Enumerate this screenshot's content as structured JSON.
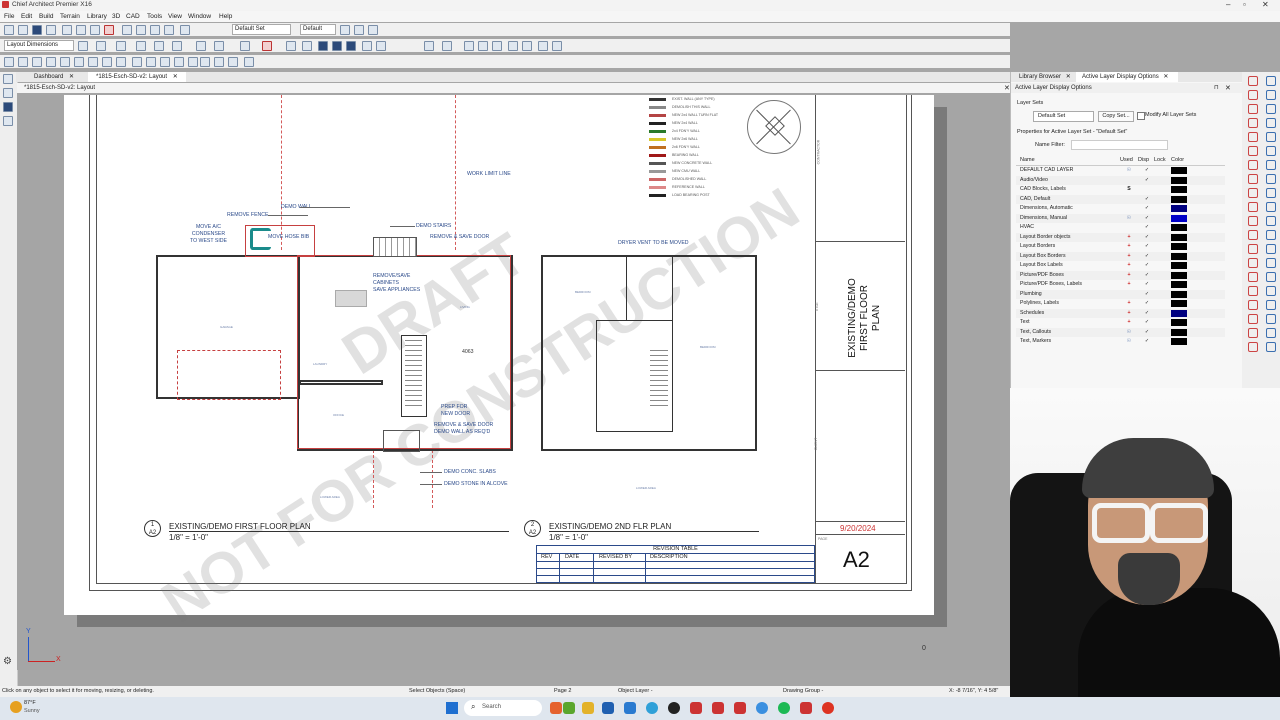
{
  "app": {
    "title": "Chief Architect Premier X16",
    "menus": [
      "File",
      "Edit",
      "Build",
      "Terrain",
      "Library",
      "3D",
      "CAD",
      "Tools",
      "View",
      "Window",
      "Help"
    ],
    "layer_set_dropdown": "Default Set",
    "default_dropdown": "Default",
    "layout_dims_dropdown": "Layout Dimensions"
  },
  "tabs": [
    {
      "label": "Dashboard"
    },
    {
      "label": "*1815-Esch-SD-v2: Layout"
    }
  ],
  "view_header": "*1815-Esch-SD-v2: Layout",
  "drawing": {
    "notes": {
      "demo_wall": "DEMO WALL",
      "remove_fence": "REMOVE FENCE",
      "move_ac": "MOVE A/C\nCONDENSER\nTO WEST SIDE",
      "move_hose_bib": "MOVE HOSE BIB",
      "demo_stairs": "DEMO STAIRS",
      "remove_save_door": "REMOVE & SAVE DOOR",
      "remove_save_cabinets": "REMOVE/SAVE\nCABINETS\nSAVE APPLIANCES",
      "work_limit_line": "WORK LIMIT LINE",
      "dryer_vent": "DRYER VENT TO BE MOVED",
      "prep_new_door": "PREP FOR\nNEW DOOR",
      "remove_save_door_demo": "REMOVE & SAVE DOOR\nDEMO WALL AS REQ'D",
      "demo_conc_slabs": "DEMO CONC. SLABS",
      "demo_stone": "DEMO STONE IN ALCOVE",
      "dim_4063": "4063"
    },
    "plan1": {
      "num": "1",
      "sheet": "A2",
      "title": "EXISTING/DEMO FIRST FLOOR PLAN",
      "scale": "1/8\" = 1'-0\""
    },
    "plan2": {
      "num": "2",
      "sheet": "A2",
      "title": "EXISTING/DEMO 2ND FLR PLAN",
      "scale": "1/8\" = 1'-0\""
    },
    "revision": {
      "title": "REVISION TABLE",
      "cols": [
        "REV",
        "DATE",
        "REVISED BY",
        "DESCRIPTION"
      ]
    },
    "title_block": {
      "contractor": "CONTRACTOR",
      "title_label": "TITLE",
      "client_label": "CLIENT",
      "sheet_title": "EXISTING/DEMO\nFIRST FLOOR\nPLAN",
      "date": "9/20/2024",
      "page_label": "PAGE",
      "page": "A2"
    },
    "watermark1": "DRAFT",
    "watermark2": "NOT FOR CONSTRUCTION",
    "legend": [
      "EXIST. WALL (ANY TYPE)",
      "DEMOLISH THIS WALL",
      "NEW 2x4 WALL TURN FLAT",
      "NEW 2x4 WALL",
      "2x4 FDN'Y WALL",
      "NEW 2x6 WALL",
      "2x6 FDN'Y WALL",
      "BEARING WALL",
      "NEW CONCRETE WALL",
      "NEW CMU WALL",
      "DEMOLISHED WALL",
      "REFERENCE WALL",
      "LOAD BEARING POST"
    ],
    "legend_colors": [
      "#333333",
      "#888888",
      "#b44444",
      "#222222",
      "#2a7a2a",
      "#d8c82a",
      "#c07020",
      "#a01818",
      "#555555",
      "#999999",
      "#cc6666",
      "#dd8888",
      "#222222"
    ]
  },
  "right_panel": {
    "tabs": [
      "Library Browser",
      "Active Layer Display Options"
    ],
    "header": "Active Layer Display Options",
    "layer_sets_label": "Layer Sets",
    "layer_set_value": "Default Set",
    "copy_set_button": "Copy Set...",
    "modify_all_label": "Modify All Layer Sets",
    "properties_label": "Properties for Active Layer Set - \"Default Set\"",
    "name_filter_label": "Name Filter:",
    "columns": [
      "Name",
      "Used",
      "Disp",
      "Lock",
      "Color"
    ],
    "layers": [
      {
        "name": "DEFAULT CAD LAYER",
        "used": "icon",
        "disp": "✓"
      },
      {
        "name": "Audio/Video",
        "used": "",
        "disp": "✓"
      },
      {
        "name": "CAD Blocks, Labels",
        "used": "S",
        "disp": ""
      },
      {
        "name": "CAD, Default",
        "used": "",
        "disp": "✓"
      },
      {
        "name": "Dimensions, Automatic",
        "used": "",
        "disp": "✓"
      },
      {
        "name": "Dimensions, Manual",
        "used": "icon",
        "disp": "✓"
      },
      {
        "name": "HVAC",
        "used": "",
        "disp": "✓"
      },
      {
        "name": "Layout Border objects",
        "used": "+",
        "disp": "✓"
      },
      {
        "name": "Layout Borders",
        "used": "+",
        "disp": "✓"
      },
      {
        "name": "Layout Box Borders",
        "used": "+",
        "disp": "✓"
      },
      {
        "name": "Layout Box Labels",
        "used": "+",
        "disp": "✓"
      },
      {
        "name": "Picture/PDF Boxes",
        "used": "+",
        "disp": "✓"
      },
      {
        "name": "Picture/PDF Boxes, Labels",
        "used": "+",
        "disp": "✓"
      },
      {
        "name": "Plumbing",
        "used": "",
        "disp": "✓"
      },
      {
        "name": "Polylines, Labels",
        "used": "+",
        "disp": "✓"
      },
      {
        "name": "Schedules",
        "used": "+",
        "disp": "✓"
      },
      {
        "name": "Text",
        "used": "+",
        "disp": "✓"
      },
      {
        "name": "Text, Callouts",
        "used": "icon",
        "disp": "✓"
      },
      {
        "name": "Text, Markers",
        "used": "icon",
        "disp": "✓"
      }
    ],
    "layer_colors": [
      "#000000",
      "#000000",
      "#000000",
      "#000000",
      "#000080",
      "#0000c8",
      "#000000",
      "#000000",
      "#000000",
      "#000000",
      "#000000",
      "#000000",
      "#000000",
      "#000000",
      "#000000",
      "#000080",
      "#000000",
      "#000000",
      "#000000"
    ]
  },
  "status": {
    "hint": "Click on any object to select it for moving, resizing, or deleting.",
    "mode": "Select Objects (Space)",
    "page": "Page 2",
    "object_layer": "Object Layer -",
    "drawing_group": "Drawing Group -",
    "coords": "X: -8 7/16\", Y: 4 5/8\""
  },
  "canvas": {
    "axis_y": "Y",
    "axis_x": "X",
    "zero_marker": "0"
  },
  "taskbar": {
    "weather_temp": "87°F",
    "weather_desc": "Sunny",
    "search_placeholder": "Search"
  }
}
